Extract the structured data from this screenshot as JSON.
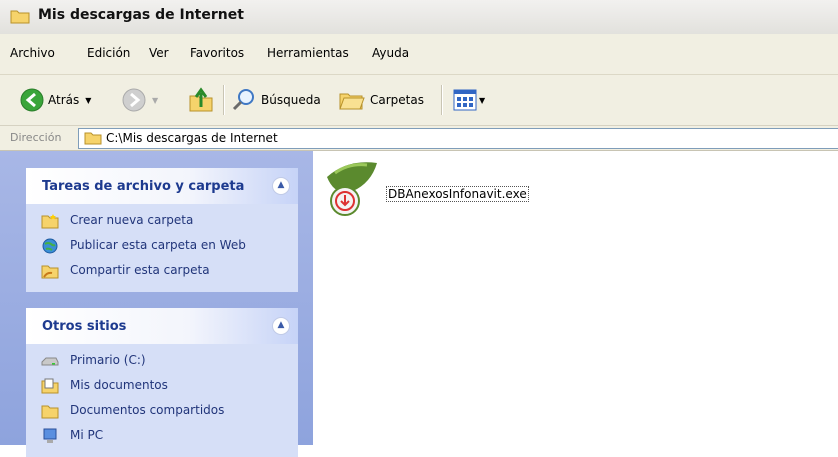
{
  "window": {
    "title": "Mis descargas de Internet"
  },
  "menu": [
    "Archivo",
    "Edición",
    "Ver",
    "Favoritos",
    "Herramientas",
    "Ayuda"
  ],
  "toolbar": {
    "back_label": "Atrás",
    "search_label": "Búsqueda",
    "folders_label": "Carpetas"
  },
  "address": {
    "label": "Dirección",
    "value": "C:\\Mis descargas de Internet"
  },
  "tasks_panel": {
    "title": "Tareas de archivo y carpeta",
    "items": [
      {
        "label": "Crear nueva carpeta",
        "icon": "new-folder-icon"
      },
      {
        "label": "Publicar esta carpeta en Web",
        "icon": "web-publish-icon"
      },
      {
        "label": "Compartir esta carpeta",
        "icon": "share-folder-icon"
      }
    ]
  },
  "places_panel": {
    "title": "Otros sitios",
    "items": [
      {
        "label": "Primario (C:)",
        "icon": "drive-icon"
      },
      {
        "label": "Mis documentos",
        "icon": "my-documents-icon"
      },
      {
        "label": "Documentos compartidos",
        "icon": "shared-documents-icon"
      },
      {
        "label": "Mi PC",
        "icon": "my-computer-icon"
      }
    ]
  },
  "files": [
    {
      "name": "DBAnexosInfonavit.exe",
      "icon": "installer-exe-icon"
    }
  ],
  "colors": {
    "panel_title": "#1d3a8f",
    "task_text": "#21357a",
    "sidebar_bg": "#8ea3dd",
    "panel_bg": "#d6dff7"
  }
}
